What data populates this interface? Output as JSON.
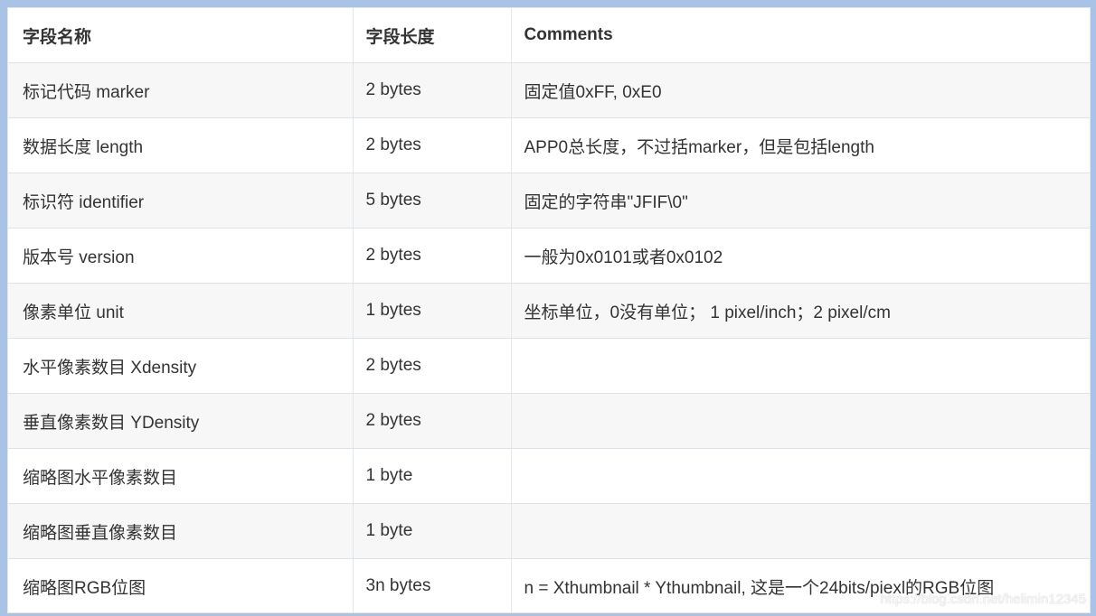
{
  "table": {
    "headers": [
      "字段名称",
      "字段长度",
      "Comments"
    ],
    "rows": [
      {
        "name": "标记代码 marker",
        "length": "2 bytes",
        "comment": "固定值0xFF, 0xE0"
      },
      {
        "name": "数据长度 length",
        "length": "2 bytes",
        "comment": "APP0总长度，不过括marker，但是包括length"
      },
      {
        "name": "标识符 identifier",
        "length": "5 bytes",
        "comment": "固定的字符串\"JFIF\\0\""
      },
      {
        "name": "版本号 version",
        "length": "2 bytes",
        "comment": "一般为0x0101或者0x0102"
      },
      {
        "name": "像素单位 unit",
        "length": "1 bytes",
        "comment": "坐标单位，0没有单位； 1 pixel/inch；2 pixel/cm"
      },
      {
        "name": "水平像素数目 Xdensity",
        "length": "2 bytes",
        "comment": ""
      },
      {
        "name": "垂直像素数目 YDensity",
        "length": "2 bytes",
        "comment": ""
      },
      {
        "name": "缩略图水平像素数目",
        "length": "1 byte",
        "comment": ""
      },
      {
        "name": "缩略图垂直像素数目",
        "length": "1 byte",
        "comment": ""
      },
      {
        "name": "缩略图RGB位图",
        "length": "3n bytes",
        "comment": "n = Xthumbnail * Ythumbnail, 这是一个24bits/piexl的RGB位图"
      }
    ]
  },
  "watermark": "https://blog.csdn.net/helimin12345"
}
